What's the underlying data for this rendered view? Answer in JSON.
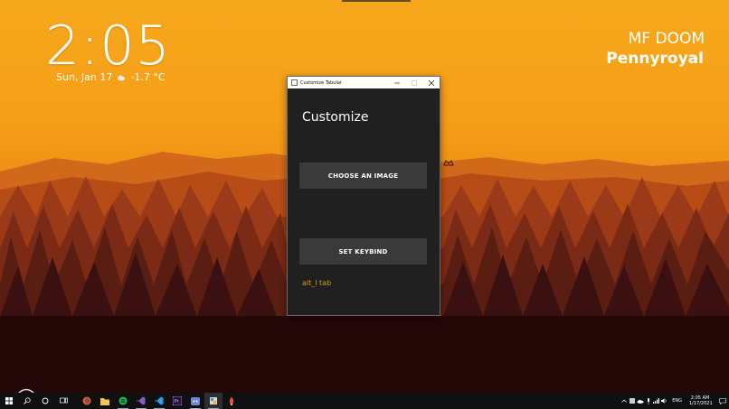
{
  "desktop": {
    "time": "2:05",
    "date": "Sun, Jan 17",
    "temperature": "-1.7 °C",
    "now_playing": {
      "artist": "MF DOOM",
      "track": "Pennyroyal"
    }
  },
  "window": {
    "title": "Customize Tabular",
    "heading": "Customize",
    "choose_image_label": "CHOOSE AN IMAGE",
    "set_keybind_label": "SET KEYBIND",
    "keybind_value": "alt_l tab",
    "controls": [
      "minimize-icon",
      "maximize-icon",
      "close-icon"
    ]
  },
  "taskbar": {
    "apps": [
      "start",
      "search",
      "cortana",
      "task-view",
      "firefox",
      "file-explorer",
      "spotify",
      "visual-studio",
      "vscode",
      "premiere-pro",
      "discord",
      "tabular",
      "app-rocket"
    ],
    "tray": {
      "language": "ENG",
      "time": "2:05 AM",
      "date": "1/17/2021"
    }
  },
  "colors": {
    "window_bg": "#202020",
    "button_bg": "#3a3a3a",
    "keybind_text": "#d4a017",
    "taskbar_bg": "#101010",
    "sky": "#f6a81c"
  }
}
